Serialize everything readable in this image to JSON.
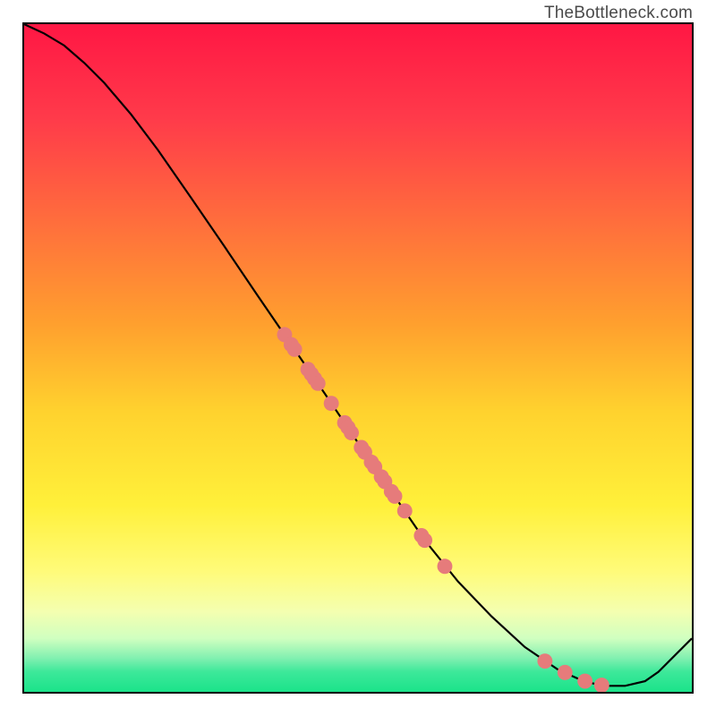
{
  "watermark": "TheBottleneck.com",
  "chart_data": {
    "type": "line",
    "title": "",
    "xlabel": "",
    "ylabel": "",
    "xlim": [
      0,
      100
    ],
    "ylim": [
      0,
      100
    ],
    "grid": false,
    "curve": [
      {
        "x": 0,
        "y": 100
      },
      {
        "x": 3,
        "y": 98.6
      },
      {
        "x": 6,
        "y": 96.8
      },
      {
        "x": 9,
        "y": 94.2
      },
      {
        "x": 12,
        "y": 91.2
      },
      {
        "x": 16,
        "y": 86.5
      },
      {
        "x": 20,
        "y": 81.2
      },
      {
        "x": 25,
        "y": 74.0
      },
      {
        "x": 30,
        "y": 66.7
      },
      {
        "x": 35,
        "y": 59.3
      },
      {
        "x": 40,
        "y": 52.0
      },
      {
        "x": 45,
        "y": 44.7
      },
      {
        "x": 50,
        "y": 37.3
      },
      {
        "x": 55,
        "y": 30.0
      },
      {
        "x": 60,
        "y": 22.7
      },
      {
        "x": 65,
        "y": 16.5
      },
      {
        "x": 70,
        "y": 11.3
      },
      {
        "x": 75,
        "y": 6.7
      },
      {
        "x": 80,
        "y": 3.3
      },
      {
        "x": 84,
        "y": 1.5
      },
      {
        "x": 87,
        "y": 0.9
      },
      {
        "x": 90,
        "y": 0.9
      },
      {
        "x": 93,
        "y": 1.6
      },
      {
        "x": 95,
        "y": 3.0
      },
      {
        "x": 97,
        "y": 5.0
      },
      {
        "x": 100,
        "y": 8.0
      }
    ],
    "points": [
      {
        "x": 39.0,
        "y": 53.5
      },
      {
        "x": 40.0,
        "y": 52.0
      },
      {
        "x": 40.5,
        "y": 51.3
      },
      {
        "x": 42.5,
        "y": 48.3
      },
      {
        "x": 43.0,
        "y": 47.6
      },
      {
        "x": 43.5,
        "y": 46.9
      },
      {
        "x": 44.0,
        "y": 46.2
      },
      {
        "x": 46.0,
        "y": 43.2
      },
      {
        "x": 48.0,
        "y": 40.3
      },
      {
        "x": 48.5,
        "y": 39.6
      },
      {
        "x": 49.0,
        "y": 38.8
      },
      {
        "x": 50.5,
        "y": 36.6
      },
      {
        "x": 51.0,
        "y": 35.9
      },
      {
        "x": 52.0,
        "y": 34.4
      },
      {
        "x": 52.5,
        "y": 33.7
      },
      {
        "x": 53.5,
        "y": 32.2
      },
      {
        "x": 54.0,
        "y": 31.5
      },
      {
        "x": 55.0,
        "y": 30.0
      },
      {
        "x": 55.5,
        "y": 29.3
      },
      {
        "x": 57.0,
        "y": 27.1
      },
      {
        "x": 59.5,
        "y": 23.4
      },
      {
        "x": 60.0,
        "y": 22.7
      },
      {
        "x": 63.0,
        "y": 18.8
      },
      {
        "x": 78.0,
        "y": 4.6
      },
      {
        "x": 81.0,
        "y": 2.9
      },
      {
        "x": 84.0,
        "y": 1.6
      },
      {
        "x": 86.5,
        "y": 1.0
      }
    ],
    "point_color": "#e67b7b",
    "curve_color": "#000000",
    "gradient_stops": [
      {
        "offset": 0,
        "color": "#ff1744"
      },
      {
        "offset": 14,
        "color": "#ff3a4a"
      },
      {
        "offset": 30,
        "color": "#ff6f3c"
      },
      {
        "offset": 45,
        "color": "#ffa02e"
      },
      {
        "offset": 58,
        "color": "#ffd22e"
      },
      {
        "offset": 72,
        "color": "#fff03a"
      },
      {
        "offset": 82,
        "color": "#fffb7a"
      },
      {
        "offset": 88,
        "color": "#f4ffb0"
      },
      {
        "offset": 92,
        "color": "#d0ffc0"
      },
      {
        "offset": 95,
        "color": "#80f0b0"
      },
      {
        "offset": 97,
        "color": "#3de89a"
      },
      {
        "offset": 100,
        "color": "#1be38a"
      }
    ]
  }
}
